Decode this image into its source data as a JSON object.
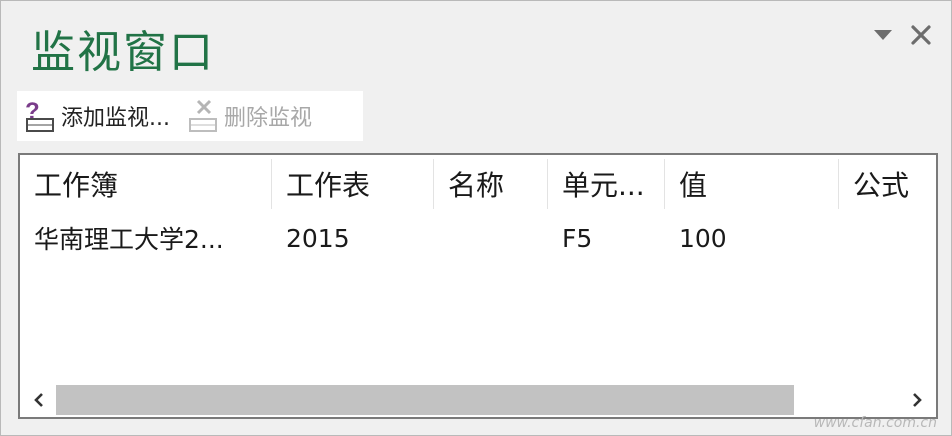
{
  "pane": {
    "title": "监视窗口",
    "accent_color": "#217346",
    "controls": {
      "menu_icon": "dropdown-triangle-icon",
      "close_icon": "close-icon"
    }
  },
  "toolbar": {
    "add_watch_label": "添加监视...",
    "add_watch_icon": "add-watch-icon",
    "delete_watch_label": "删除监视",
    "delete_watch_icon": "delete-watch-icon",
    "delete_watch_enabled": false
  },
  "watch_list": {
    "columns": [
      "工作簿",
      "工作表",
      "名称",
      "单元...",
      "值",
      "公式"
    ],
    "rows": [
      {
        "workbook": "华南理工大学2...",
        "sheet": "2015",
        "name": "",
        "cell": "F5",
        "value": "100",
        "formula": ""
      }
    ]
  },
  "scrollbar": {
    "left_icon": "chevron-left-icon",
    "right_icon": "chevron-right-icon"
  },
  "watermark": "www.cfan.com.cn"
}
